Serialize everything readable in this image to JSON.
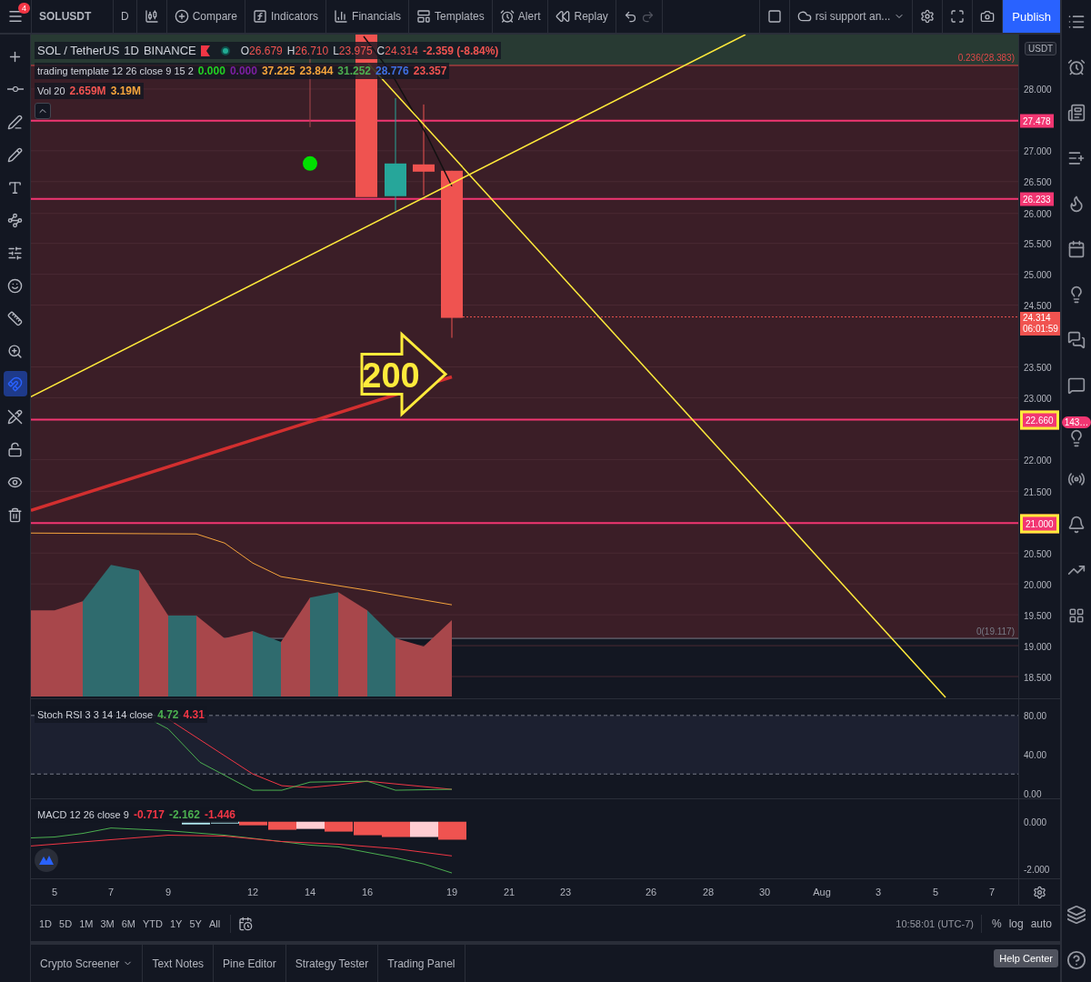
{
  "toolbar": {
    "notification_count": "4",
    "symbol": "SOLUSDT",
    "interval": "D",
    "buttons": [
      {
        "label": "Compare"
      },
      {
        "label": "Indicators"
      },
      {
        "label": "Financials"
      },
      {
        "label": "Templates"
      },
      {
        "label": "Alert"
      },
      {
        "label": "Replay"
      }
    ],
    "layout_name": "rsi support an...",
    "publish": "Publish"
  },
  "left_tools": [
    {
      "selected": false
    },
    {
      "selected": false
    },
    {
      "selected": false
    },
    {
      "selected": false
    },
    {
      "selected": false
    },
    {
      "selected": false
    },
    {
      "selected": false
    },
    {
      "selected": false
    },
    {
      "selected": false
    },
    {
      "selected": false
    },
    {
      "selected": true
    },
    {
      "selected": false
    },
    {
      "selected": false
    },
    {
      "selected": false
    },
    {
      "selected": false
    }
  ],
  "legend": {
    "symbol": "SOL / TetherUS",
    "interval": "1D",
    "exchange": "BINANCE",
    "ohlc": [
      {
        "label": "O",
        "value": "26.679"
      },
      {
        "label": "H",
        "value": "26.710"
      },
      {
        "label": "L",
        "value": "23.975"
      },
      {
        "label": "C",
        "value": "24.314"
      }
    ],
    "change": "-2.359 (-8.84%)",
    "indicators": [
      {
        "name": "trading template 12 26 close 9 15 2",
        "values": [
          {
            "text": "0.000",
            "color": "#22d022"
          },
          {
            "text": "0.000",
            "color": "#7b1fa2"
          },
          {
            "text": "37.225",
            "color": "#f6a53c"
          },
          {
            "text": "23.844",
            "color": "#f6a53c"
          },
          {
            "text": "31.252",
            "color": "#4caf50"
          },
          {
            "text": "28.776",
            "color": "#3f6fe0"
          },
          {
            "text": "23.357",
            "color": "#f05350"
          }
        ]
      },
      {
        "name": "Vol 20",
        "values": [
          {
            "text": "2.659M",
            "color": "#f05350"
          },
          {
            "text": "3.19M",
            "color": "#f6a53c"
          }
        ]
      }
    ]
  },
  "chart": {
    "currency": "USDT",
    "fib_levels": [
      {
        "label": "0.236(28.383)"
      },
      {
        "label": "0(19.117)"
      }
    ],
    "price_labels": [
      "28.000",
      "27.000",
      "26.500",
      "26.000",
      "25.500",
      "25.000",
      "24.500",
      "23.500",
      "23.000",
      "22.000",
      "21.500",
      "20.500",
      "20.000",
      "19.500",
      "19.000",
      "18.500"
    ],
    "level_badges": [
      {
        "value": "27.478",
        "outlined": false
      },
      {
        "value": "26.233",
        "outlined": false
      },
      {
        "value": "22.660",
        "outlined": true
      },
      {
        "value": "21.000",
        "outlined": true
      }
    ],
    "last_price": {
      "value": "24.314",
      "countdown": "06:01:59"
    },
    "arrow_label": "200"
  },
  "stoch_rsi": {
    "name": "Stoch RSI 3 3 14 14 close",
    "values": [
      {
        "text": "4.72",
        "color": "#4caf50"
      },
      {
        "text": "4.31",
        "color": "#f23645"
      }
    ],
    "axis": [
      "80.00",
      "40.00",
      "0.00"
    ]
  },
  "macd": {
    "name": "MACD 12 26 close 9",
    "values": [
      {
        "text": "-0.717",
        "color": "#f23645"
      },
      {
        "text": "-2.162",
        "color": "#4caf50"
      },
      {
        "text": "-1.446",
        "color": "#f23645"
      }
    ],
    "axis": [
      "0.000",
      "-2.000"
    ]
  },
  "time_axis": [
    "5",
    "7",
    "9",
    "12",
    "14",
    "16",
    "19",
    "21",
    "23",
    "26",
    "28",
    "30",
    "Aug",
    "3",
    "5",
    "7"
  ],
  "range_buttons": [
    "1D",
    "5D",
    "1M",
    "3M",
    "6M",
    "YTD",
    "1Y",
    "5Y",
    "All"
  ],
  "clock": "10:58:01 (UTC-7)",
  "scale_buttons": [
    "%",
    "log",
    "auto"
  ],
  "bottom_tabs": [
    {
      "label": "Crypto Screener",
      "dropdown": true
    },
    {
      "label": "Text Notes",
      "dropdown": false
    },
    {
      "label": "Pine Editor",
      "dropdown": false
    },
    {
      "label": "Strategy Tester",
      "dropdown": false
    },
    {
      "label": "Trading Panel",
      "dropdown": false
    }
  ],
  "right_sidebar": {
    "badge": "143…",
    "tooltip": "Help Center"
  }
}
